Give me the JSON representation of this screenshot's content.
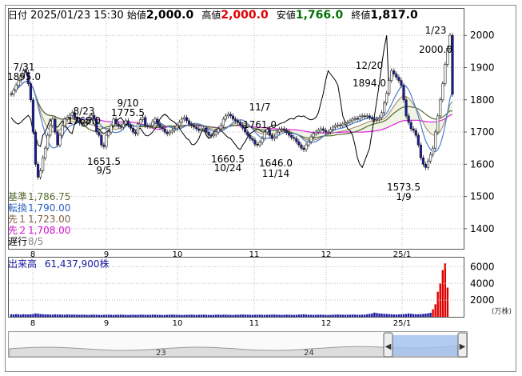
{
  "header": {
    "date_label": "日付",
    "datetime": "2025/01/23 15:30",
    "open_label": "始値",
    "open": "2,000.0",
    "high_label": "高値",
    "high": "2,000.0",
    "low_label": "安値",
    "low": "1,766.0",
    "close_label": "終値",
    "close": "1,817.0"
  },
  "colors": {
    "candle_up": "#ffffff",
    "candle_down": "#1a1aa0",
    "kijun": "#556b2f",
    "tenkan": "#4a7fd0",
    "senkou1": "#a08060",
    "senkou2": "#e020e0",
    "chikou": "#000000",
    "volume": "#1a1aa0",
    "volume_recent": "#e00000",
    "grid": "#bbbbbb"
  },
  "legend": {
    "kijun_label": "基準",
    "kijun_value": "1,786.75",
    "tenkan_label": "転換",
    "tenkan_value": "1,790.00",
    "senkou1_label": "先１",
    "senkou1_value": "1,723.00",
    "senkou2_label": "先２",
    "senkou2_value": "1,708.00",
    "chikou_label": "遅行",
    "chikou_value": "8/5"
  },
  "volume_label": "出来高",
  "volume_value": "61,437,900株",
  "volume_unit": "(万株)",
  "navigator_labels": [
    "23",
    "24"
  ],
  "chart_data": {
    "type": "candlestick",
    "title": "",
    "price_axis": {
      "ticks": [
        1400,
        1500,
        1600,
        1700,
        1800,
        1900,
        2000
      ],
      "range": [
        1340,
        2080
      ]
    },
    "volume_axis": {
      "ticks": [
        2000,
        4000,
        6000
      ],
      "range": [
        0,
        7000
      ],
      "unit": "万株"
    },
    "x_tick_labels": [
      "8",
      "9",
      "10",
      "11",
      "12",
      "25/1"
    ],
    "annotations": [
      {
        "date": "7/31",
        "value": "1895.0",
        "kind": "high"
      },
      {
        "date": "8/23",
        "value": "1768.0",
        "kind": "high"
      },
      {
        "date": "9/10",
        "value": "1775.5",
        "kind": "high"
      },
      {
        "date": "9/5",
        "value": "1651.5",
        "kind": "low"
      },
      {
        "date": "10/24",
        "value": "1660.5",
        "kind": "low"
      },
      {
        "date": "11/7",
        "value": "1761.0",
        "kind": "high"
      },
      {
        "date": "11/14",
        "value": "1646.0",
        "kind": "low"
      },
      {
        "date": "12/20",
        "value": "1894.0",
        "kind": "high"
      },
      {
        "date": "1/9",
        "value": "1573.5",
        "kind": "low"
      },
      {
        "date": "1/23",
        "value": "2000.0",
        "kind": "high"
      }
    ],
    "close_series": [
      1818,
      1830,
      1845,
      1860,
      1875,
      1890,
      1885,
      1850,
      1800,
      1700,
      1600,
      1560,
      1580,
      1620,
      1650,
      1690,
      1720,
      1740,
      1700,
      1660,
      1690,
      1720,
      1740,
      1745,
      1752,
      1760,
      1745,
      1735,
      1728,
      1725,
      1730,
      1738,
      1745,
      1752,
      1740,
      1700,
      1690,
      1660,
      1655,
      1690,
      1700,
      1720,
      1740,
      1725,
      1718,
      1715,
      1725,
      1735,
      1722,
      1712,
      1700,
      1695,
      1725,
      1738,
      1745,
      1720,
      1718,
      1720,
      1732,
      1740,
      1725,
      1715,
      1710,
      1700,
      1695,
      1700,
      1705,
      1710,
      1720,
      1730,
      1740,
      1745,
      1735,
      1725,
      1720,
      1715,
      1710,
      1705,
      1708,
      1712,
      1700,
      1690,
      1688,
      1692,
      1700,
      1710,
      1720,
      1740,
      1750,
      1755,
      1750,
      1740,
      1735,
      1730,
      1722,
      1712,
      1700,
      1690,
      1680,
      1675,
      1662,
      1660,
      1668,
      1680,
      1700,
      1708,
      1690,
      1680,
      1685,
      1700,
      1708,
      1710,
      1705,
      1698,
      1690,
      1683,
      1680,
      1670,
      1660,
      1650,
      1646,
      1660,
      1670,
      1685,
      1695,
      1700,
      1705,
      1710,
      1705,
      1700,
      1700,
      1708,
      1715,
      1720,
      1722,
      1720,
      1725,
      1728,
      1730,
      1735,
      1740,
      1742,
      1740,
      1748,
      1750,
      1748,
      1750,
      1745,
      1740,
      1738,
      1740,
      1745,
      1760,
      1790,
      1820,
      1860,
      1890,
      1880,
      1870,
      1860,
      1845,
      1800,
      1750,
      1730,
      1710,
      1705,
      1690,
      1660,
      1620,
      1600,
      1590,
      1610,
      1630,
      1650,
      1700,
      1750,
      1800,
      1850,
      1910,
      1960,
      2000,
      1817
    ],
    "volume_series": [
      300,
      280,
      320,
      300,
      260,
      310,
      290,
      280,
      300,
      320,
      400,
      380,
      330,
      300,
      290,
      280,
      270,
      260,
      290,
      280,
      270,
      260,
      250,
      280,
      260,
      250,
      270,
      260,
      240,
      260,
      250,
      240,
      230,
      250,
      260,
      240,
      230,
      220,
      240,
      250,
      260,
      240,
      230,
      240,
      250,
      260,
      240,
      230,
      220,
      240,
      250,
      230,
      240,
      260,
      250,
      240,
      230,
      240,
      260,
      250,
      240,
      230,
      220,
      230,
      240,
      250,
      260,
      250,
      240,
      230,
      220,
      230,
      240,
      250,
      260,
      240,
      230,
      240,
      250,
      260,
      240,
      230,
      220,
      230,
      250,
      260,
      240,
      250,
      260,
      240,
      230,
      220,
      240,
      250,
      260,
      270,
      260,
      250,
      240,
      230,
      240,
      250,
      260,
      240,
      230,
      240,
      250,
      260,
      270,
      250,
      240,
      230,
      240,
      260,
      250,
      240,
      230,
      240,
      260,
      280,
      300,
      260,
      250,
      240,
      230,
      240,
      250,
      260,
      240,
      230,
      220,
      230,
      250,
      260,
      270,
      260,
      250,
      240,
      250,
      260,
      270,
      260,
      250,
      240,
      250,
      260,
      300,
      350,
      400,
      500,
      450,
      400,
      380,
      350,
      340,
      320,
      300,
      280,
      270,
      290,
      300,
      320,
      340,
      400,
      360,
      330,
      310,
      300,
      320,
      350,
      380,
      420,
      480,
      900,
      1500,
      3000,
      4000,
      5600,
      6400,
      3500
    ],
    "volume_recent_count": 7
  }
}
